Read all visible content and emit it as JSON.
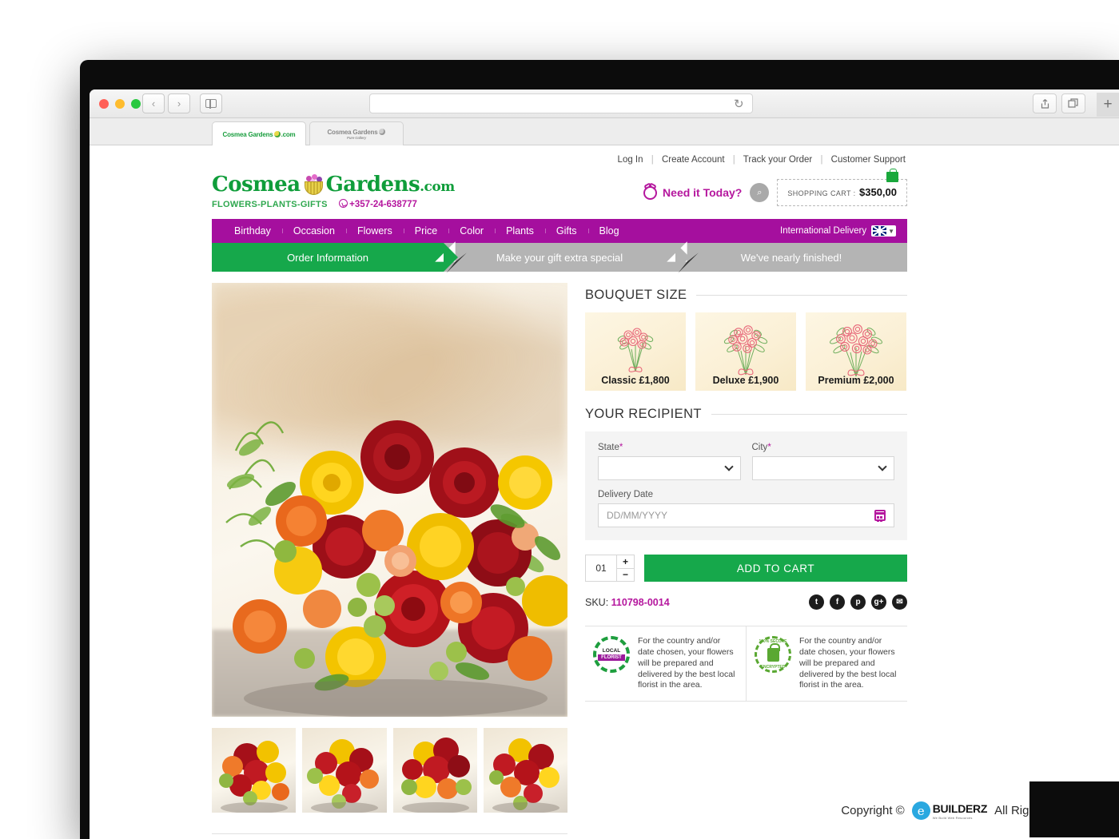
{
  "browser": {
    "traffic_lights": [
      "close",
      "minimize",
      "maximize"
    ],
    "back_icon": "‹",
    "forward_icon": "›",
    "sidebar_icon": "sidebar-icon",
    "reload_icon": "↻",
    "share_icon": "↑",
    "tabs_icon": "⧉",
    "newtab_label": "+",
    "url_value": "",
    "url_placeholder": "",
    "tabs": [
      {
        "title": "Cosmea Gardens",
        "suffix": ".com",
        "subtitle": "",
        "active": true
      },
      {
        "title": "Cosmea Gardens",
        "suffix": "",
        "subtitle": "Pure Gallery",
        "active": false
      }
    ]
  },
  "utility_nav": {
    "items": [
      "Log In",
      "Create Account",
      "Track your Order",
      "Customer Support"
    ],
    "separator": "|"
  },
  "brand": {
    "name_part1": "Cosmea",
    "name_part2": "Gardens",
    "dotcom": ".com",
    "tagline": "FLOWERS-PLANTS-GIFTS",
    "phone": "+357-24-638777"
  },
  "header_right": {
    "need_it_today": "Need it Today?",
    "search_icon": "⌕",
    "cart_label": "SHOPPING CART :",
    "cart_total": "$350,00"
  },
  "menu": {
    "items": [
      "Birthday",
      "Occasion",
      "Flowers",
      "Price",
      "Color",
      "Plants",
      "Gifts",
      "Blog"
    ],
    "international_delivery": "International Delivery",
    "flag": "uk-flag-icon",
    "bar_color": "#a50f9e"
  },
  "steps": [
    {
      "label": "Order Information",
      "active": true
    },
    {
      "label": "Make your gift extra special",
      "active": false
    },
    {
      "label": "We've nearly finished!",
      "active": false
    }
  ],
  "gallery": {
    "main_alt": "Red yellow and orange bouquet",
    "thumbnails": [
      "thumb-1",
      "thumb-2",
      "thumb-3",
      "thumb-4"
    ]
  },
  "bouquet_size": {
    "title": "BOUQUET SIZE",
    "options": [
      {
        "name": "Classic",
        "price": "£1,800",
        "label": "Classic £1,800"
      },
      {
        "name": "Deluxe",
        "price": "£1,900",
        "label": "Deluxe £1,900"
      },
      {
        "name": "Premium",
        "price": "£2,000",
        "label": "Premium £2,000"
      }
    ]
  },
  "recipient": {
    "title": "YOUR RECIPIENT",
    "state_label": "State",
    "state_required": "*",
    "state_value": "",
    "city_label": "City",
    "city_required": "*",
    "city_value": "",
    "delivery_date_label": "Delivery Date",
    "delivery_date_placeholder": "DD/MM/YYYY",
    "delivery_date_value": ""
  },
  "purchase": {
    "quantity": "01",
    "increment": "+",
    "decrement": "−",
    "add_to_cart": "ADD TO CART",
    "sku_label": "SKU:",
    "sku_value": "110798-0014",
    "socials": [
      {
        "name": "twitter",
        "glyph": "t"
      },
      {
        "name": "facebook",
        "glyph": "f"
      },
      {
        "name": "pinterest",
        "glyph": "p"
      },
      {
        "name": "google-plus",
        "glyph": "g+"
      },
      {
        "name": "email",
        "glyph": "✉"
      }
    ]
  },
  "trust": [
    {
      "badge": "local-florist-badge",
      "badge_line1": "LOCAL",
      "badge_line2": "FLORIST",
      "text": "For the country and/or date chosen, your flowers will be prepared and delivered by the best local florist in the area."
    },
    {
      "badge": "secure-encrypted-badge",
      "badge_line1": "100% SECURE",
      "badge_line2": "ENCRYPTED",
      "text": "For the country and/or date chosen, your flowers will be prepared and delivered by the best local florist in the area."
    }
  ],
  "footer": {
    "copyright": "Copyright ©",
    "brand_e": "e",
    "brand_name": "BUILDERZ",
    "brand_sub": "We Build Web Resources",
    "rights": "All Rights Reserved."
  }
}
